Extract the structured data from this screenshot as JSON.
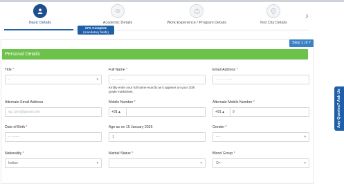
{
  "stepper": {
    "steps": [
      {
        "label": "Basic Details",
        "icon": "user-icon",
        "active": true
      },
      {
        "label": "Academic Details",
        "icon": "circle-icon",
        "active": false
      },
      {
        "label": "Work Experience / Program Details",
        "icon": "briefcase-icon",
        "active": false
      },
      {
        "label": "Test City Details",
        "icon": "location-pin-icon",
        "active": false
      }
    ],
    "next_arrow": "›"
  },
  "progress": {
    "percent_text": "37% Complete",
    "note": "(mandatory fields)"
  },
  "step_indicator": "Step 1 of 7",
  "section_title": "Personal Details",
  "fields": {
    "title": {
      "label": "Title",
      "required": "*",
      "value": "··"
    },
    "full_name": {
      "label": "Full Name",
      "required": "*",
      "value": "··· ········",
      "hint": "Kindly enter your full name exactly as it appears on your 10th grade marksheet."
    },
    "email": {
      "label": "Email Address",
      "required": "*",
      "value": "·  ·  ·  ·  ·  ·  ·  ·"
    },
    "alt_email": {
      "label": "Alternate Email Address",
      "placeholder": "eg. john@gmail.com"
    },
    "mobile": {
      "label": "Mobile Number",
      "required": "*",
      "code": "+91",
      "value": ""
    },
    "alt_mobile": {
      "label": "Alternate Mobile Number",
      "required": "*",
      "code": "+91",
      "value": "9"
    },
    "dob": {
      "label": "Date of Birth",
      "required": "*",
      "value": "·· ·· ····"
    },
    "age": {
      "label": "Age as on 15 January 2026",
      "value": "1"
    },
    "gender": {
      "label": "Gender",
      "required": "*",
      "value": "····"
    },
    "nationality": {
      "label": "Nationality",
      "required": "*",
      "value": "Indian"
    },
    "marital": {
      "label": "Marital Status",
      "required": "*",
      "value": ""
    },
    "blood": {
      "label": "Blood Group",
      "required": "*",
      "value": "O+"
    }
  },
  "side_tab": "Any Queries? Ask Us",
  "colors": {
    "brand_blue": "#1f5fa8",
    "section_green": "#6cc24a",
    "required_red": "#e53935"
  }
}
